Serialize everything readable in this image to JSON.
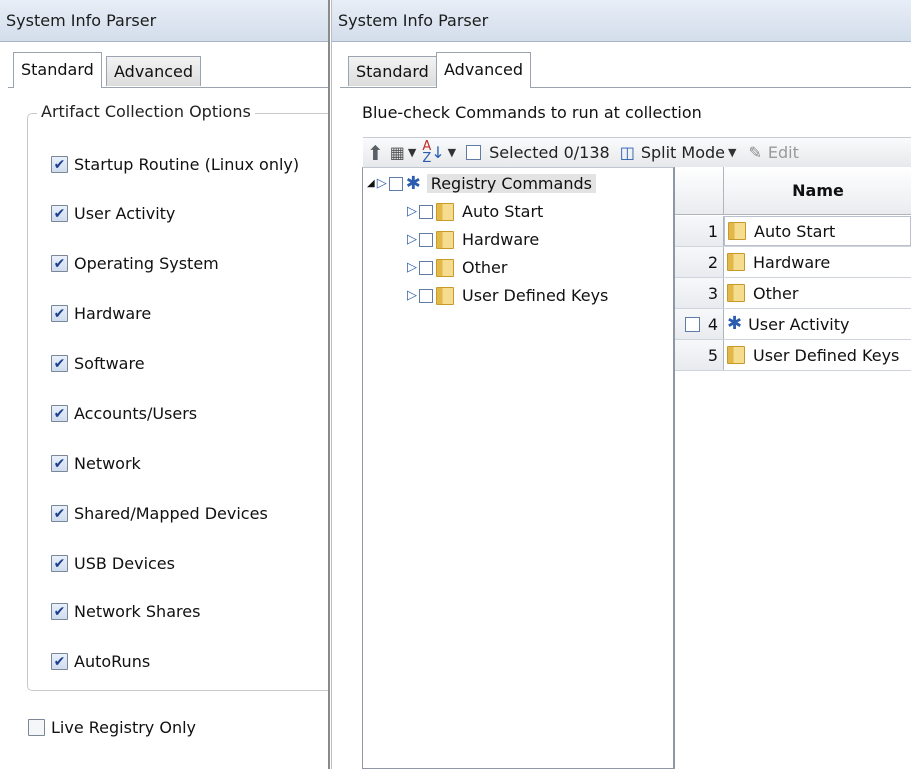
{
  "left": {
    "title": "System Info Parser",
    "tabs": [
      {
        "label": "Standard",
        "active": true
      },
      {
        "label": "Advanced",
        "active": false
      }
    ],
    "group_title": "Artifact Collection Options",
    "options": [
      {
        "label": "Startup Routine (Linux only)",
        "checked": true
      },
      {
        "label": "User Activity",
        "checked": true
      },
      {
        "label": "Operating System",
        "checked": true
      },
      {
        "label": "Hardware",
        "checked": true
      },
      {
        "label": "Software",
        "checked": true
      },
      {
        "label": "Accounts/Users",
        "checked": true
      },
      {
        "label": "Network",
        "checked": true
      },
      {
        "label": "Shared/Mapped Devices",
        "checked": true
      },
      {
        "label": "USB Devices",
        "checked": true
      },
      {
        "label": "Network Shares",
        "checked": true
      },
      {
        "label": "AutoRuns",
        "checked": true
      }
    ],
    "live_registry": {
      "label": "Live Registry Only",
      "checked": false
    }
  },
  "right": {
    "title": "System Info Parser",
    "tabs": [
      {
        "label": "Standard",
        "active": false
      },
      {
        "label": "Advanced",
        "active": true
      }
    ],
    "instruction": "Blue-check Commands to run at collection",
    "toolbar": {
      "selected": "Selected 0/138",
      "split_mode": "Split Mode",
      "edit": "Edit"
    },
    "tree": {
      "root": "Registry Commands",
      "children": [
        "Auto Start",
        "Hardware",
        "Other",
        "User Defined Keys"
      ]
    },
    "grid": {
      "header": "Name",
      "rows": [
        {
          "num": "1",
          "name": "Auto Start",
          "icon": "folder-icon"
        },
        {
          "num": "2",
          "name": "Hardware",
          "icon": "folder-icon"
        },
        {
          "num": "3",
          "name": "Other",
          "icon": "folder-icon"
        },
        {
          "num": "4",
          "name": "User Activity",
          "icon": "gear-icon"
        },
        {
          "num": "5",
          "name": "User Defined Keys",
          "icon": "folder-icon"
        }
      ]
    }
  }
}
